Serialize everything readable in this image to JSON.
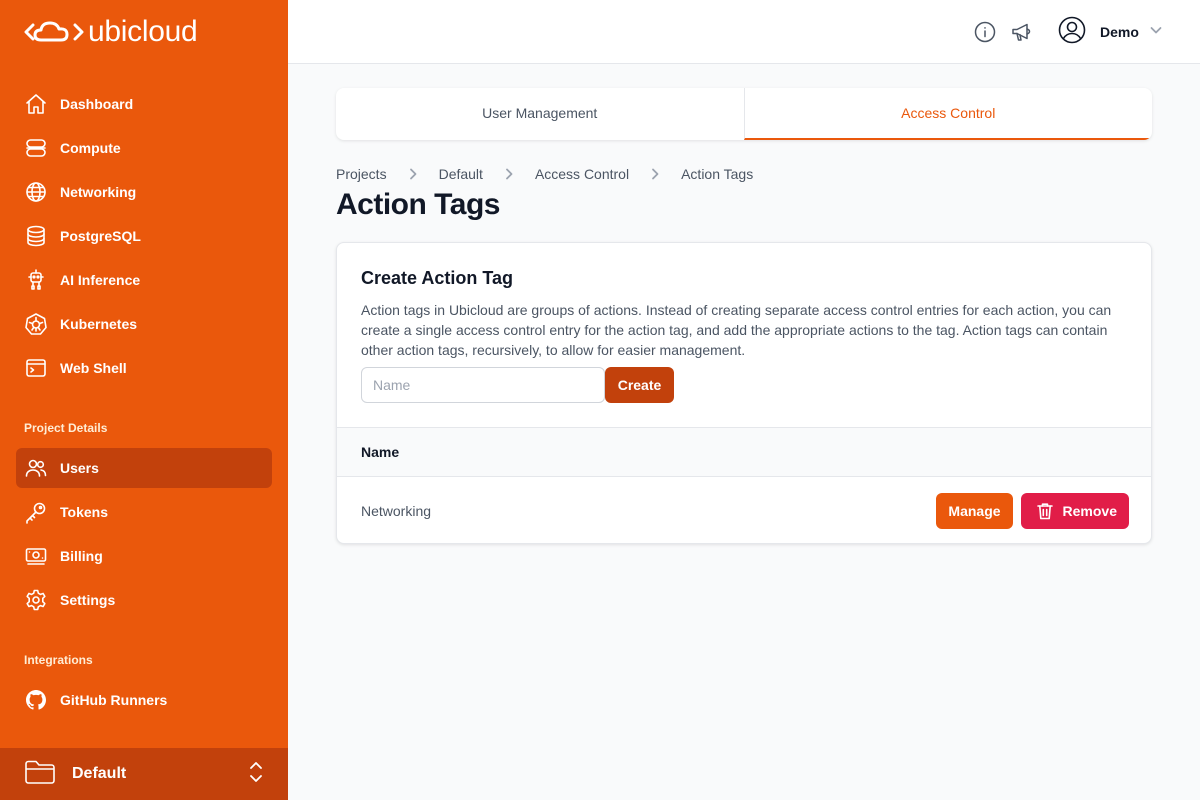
{
  "brand": {
    "name": "ubicloud"
  },
  "sidebar": {
    "main_items": [
      {
        "label": "Dashboard",
        "icon": "home-icon"
      },
      {
        "label": "Compute",
        "icon": "server-icon"
      },
      {
        "label": "Networking",
        "icon": "globe-icon"
      },
      {
        "label": "PostgreSQL",
        "icon": "database-icon"
      },
      {
        "label": "AI Inference",
        "icon": "robot-icon"
      },
      {
        "label": "Kubernetes",
        "icon": "kubernetes-icon"
      },
      {
        "label": "Web Shell",
        "icon": "terminal-icon"
      }
    ],
    "project_section_title": "Project Details",
    "project_items": [
      {
        "label": "Users",
        "icon": "users-icon",
        "active": true
      },
      {
        "label": "Tokens",
        "icon": "key-icon"
      },
      {
        "label": "Billing",
        "icon": "banknote-icon"
      },
      {
        "label": "Settings",
        "icon": "gear-icon"
      }
    ],
    "integrations_title": "Integrations",
    "integration_items": [
      {
        "label": "GitHub Runners",
        "icon": "github-icon"
      }
    ],
    "project_switcher": {
      "label": "Default",
      "icon": "folder-icon"
    }
  },
  "topbar": {
    "icons": [
      "info-icon",
      "megaphone-icon"
    ],
    "user": {
      "name": "Demo",
      "icon": "user-circle-icon"
    }
  },
  "tabs": [
    {
      "label": "User Management",
      "active": false
    },
    {
      "label": "Access Control",
      "active": true
    }
  ],
  "breadcrumb": [
    "Projects",
    "Default",
    "Access Control",
    "Action Tags"
  ],
  "page": {
    "title": "Action Tags"
  },
  "create_card": {
    "title": "Create Action Tag",
    "description": "Action tags in Ubicloud are groups of actions. Instead of creating separate access control entries for each action, you can create a single access control entry for the action tag, and add the appropriate actions to the tag. Action tags can contain other action tags, recursively, to allow for easier management.",
    "input_value": "",
    "input_placeholder": "Name",
    "create_label": "Create"
  },
  "table": {
    "columns": [
      "Name"
    ],
    "rows": [
      {
        "name": "Networking",
        "manage_label": "Manage",
        "remove_label": "Remove"
      }
    ]
  },
  "colors": {
    "brand": "#ea580c",
    "brand_dark": "#c2410c",
    "danger": "#e11d48"
  }
}
